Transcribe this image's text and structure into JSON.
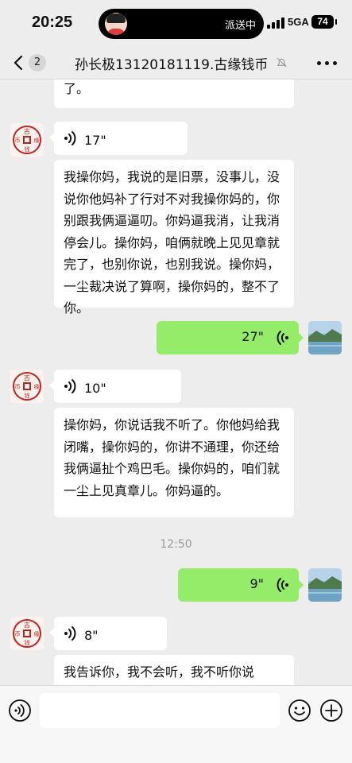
{
  "status_bar": {
    "time": "20:25",
    "island_text": "派送中",
    "network": "5GA",
    "battery": "74"
  },
  "nav": {
    "back_count": "2",
    "title": "孙长极13120181119.古缘钱币"
  },
  "messages": {
    "partial_top": "了。",
    "voice1_duration": "17\"",
    "text1": "我操你妈，我说的是旧票，没事儿，没说你他妈补了行对不对我操你妈的，你别跟我俩逼逼叨。你妈逼我消，让我消停会儿。操你妈，咱俩就晚上见见章就完了，也别你说，也别我说。操你妈，一尘裁决说了算啊，操你妈的，整不了你。",
    "out_voice1_duration": "27\"",
    "voice2_duration": "10\"",
    "text2": "操你妈，你说话我不听了。你他妈给我闭嘴，操你妈的，你讲不通理，你还给我俩逼扯个鸡巴毛。操你妈的，咱们就一尘上见真章儿。你妈逼的。",
    "timestamp": "12:50",
    "out_voice2_duration": "9\"",
    "voice3_duration": "8\"",
    "text3_line1": "我告诉你，我不会听，我不听你说"
  },
  "avatar_logo_chars": [
    "古",
    "缘",
    "钱",
    "币"
  ],
  "input": {
    "placeholder": ""
  },
  "colors": {
    "background": "#ededed",
    "outgoing_bubble": "#95ec69",
    "incoming_bubble": "#ffffff",
    "logo_red": "#c8201f"
  }
}
